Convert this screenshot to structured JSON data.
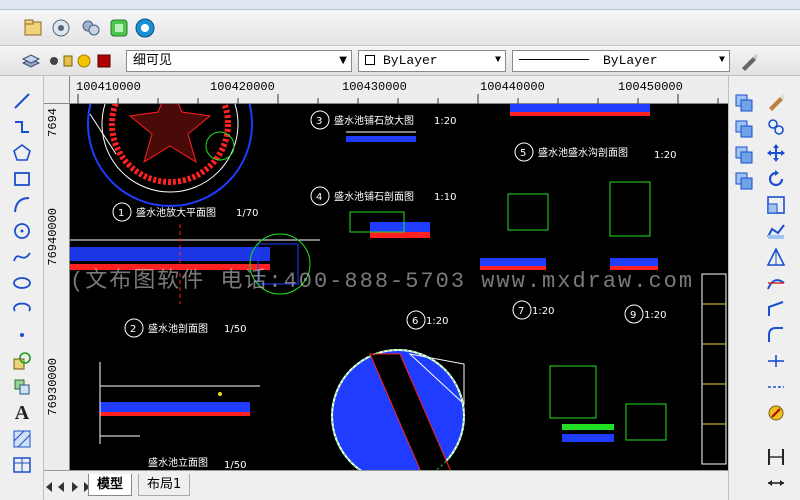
{
  "toolbar1": {
    "icons": [
      "open-file-icon",
      "preview-icon",
      "layers-tool-icon",
      "properties-icon",
      "help-icon"
    ]
  },
  "layer_bar": {
    "layer_name": "细可见",
    "color_value": "ByLayer",
    "linetype_value": "ByLayer"
  },
  "ruler": {
    "x_labels": [
      "100410000",
      "100420000",
      "100430000",
      "100440000",
      "100450000"
    ],
    "y_labels": [
      "7694",
      "76940000",
      "76930000"
    ]
  },
  "drawing": {
    "titles": [
      "盛水池放大平面图",
      "盛水池剖面图",
      "盛水池立面图",
      "盛水池铺石放大图",
      "盛水池铺石剖面图",
      "盛水池盛水沟剖面图"
    ],
    "numbers": [
      "1",
      "2",
      "3",
      "4",
      "5",
      "6",
      "7",
      "9"
    ],
    "scales": [
      "1/70",
      "1/50",
      "1/50",
      "1:20",
      "1:10",
      "1:20",
      "1:20",
      "1:20",
      "1:20"
    ],
    "watermark": "(文布图软件  电话:400-888-5703  www.mxdraw.com"
  },
  "tabs": {
    "model": "模型",
    "layout1": "布局1"
  },
  "colors": {
    "canvas_bg": "#000000",
    "cad_blue": "#1f3cff",
    "cad_red": "#ff2020",
    "cad_green": "#22e022",
    "cad_yellow": "#f0d020",
    "cad_cyan": "#20e0e0"
  }
}
